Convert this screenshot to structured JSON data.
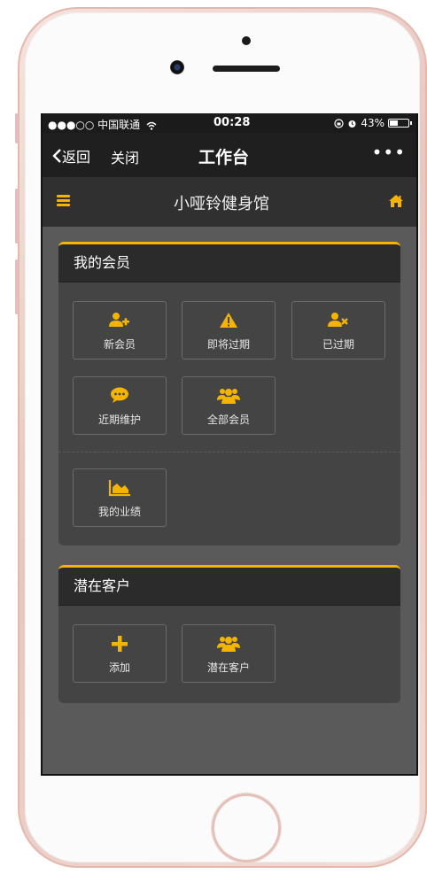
{
  "status_bar": {
    "carrier": "●●●○○ 中国联通",
    "time": "00:28",
    "battery": "43%",
    "battery_level": 0.43
  },
  "nav_bar": {
    "back_label": "返回",
    "close_label": "关闭",
    "title": "工作台",
    "more_label": "•••"
  },
  "app_header": {
    "title": "小哑铃健身馆"
  },
  "members_card": {
    "title": "我的会员",
    "tiles": [
      {
        "label": "新会员",
        "icon": "add-user-icon"
      },
      {
        "label": "即将过期",
        "icon": "warning-icon"
      },
      {
        "label": "已过期",
        "icon": "remove-user-icon"
      },
      {
        "label": "近期维护",
        "icon": "chat-icon"
      },
      {
        "label": "全部会员",
        "icon": "group-icon"
      },
      {
        "label": "我的业绩",
        "icon": "area-chart-icon"
      }
    ]
  },
  "prospects_card": {
    "title": "潜在客户",
    "tiles": [
      {
        "label": "添加",
        "icon": "plus-icon"
      },
      {
        "label": "潜在客户",
        "icon": "group-icon"
      }
    ]
  },
  "colors": {
    "accent": "#f4b400",
    "screen_bg": "#5a5a5a",
    "card_bg": "#444444",
    "nav_bg": "#1f1f1f"
  }
}
